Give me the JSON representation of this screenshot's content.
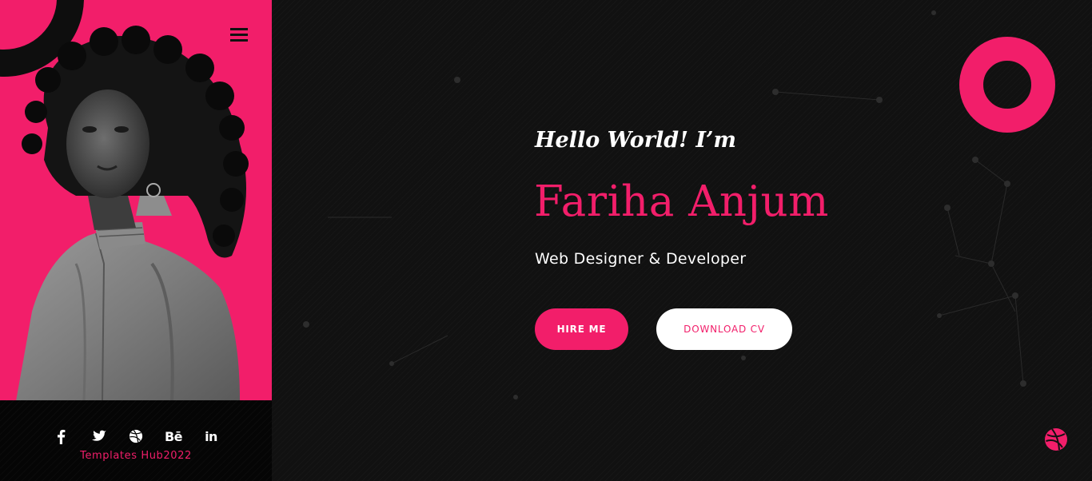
{
  "sidebar": {
    "menu_icon": "hamburger-menu-icon",
    "portrait_alt": "portrait",
    "social": [
      {
        "name": "facebook",
        "icon": "facebook-icon"
      },
      {
        "name": "twitter",
        "icon": "twitter-icon"
      },
      {
        "name": "dribbble",
        "icon": "dribbble-icon"
      },
      {
        "name": "behance",
        "icon": "behance-icon",
        "label": "Bē"
      },
      {
        "name": "linkedin",
        "icon": "linkedin-icon",
        "label": "in"
      }
    ],
    "credit": "Templates Hub2022"
  },
  "hero": {
    "greeting": "Hello World! I’m",
    "name": "Fariha Anjum",
    "role": "Web Designer & Developer",
    "hire_label": "HIRE ME",
    "cv_label": "DOWNLOAD CV",
    "floating_icon": "dribbble-icon"
  },
  "colors": {
    "accent": "#f21e6a",
    "background": "#111111",
    "text": "#ffffff"
  }
}
